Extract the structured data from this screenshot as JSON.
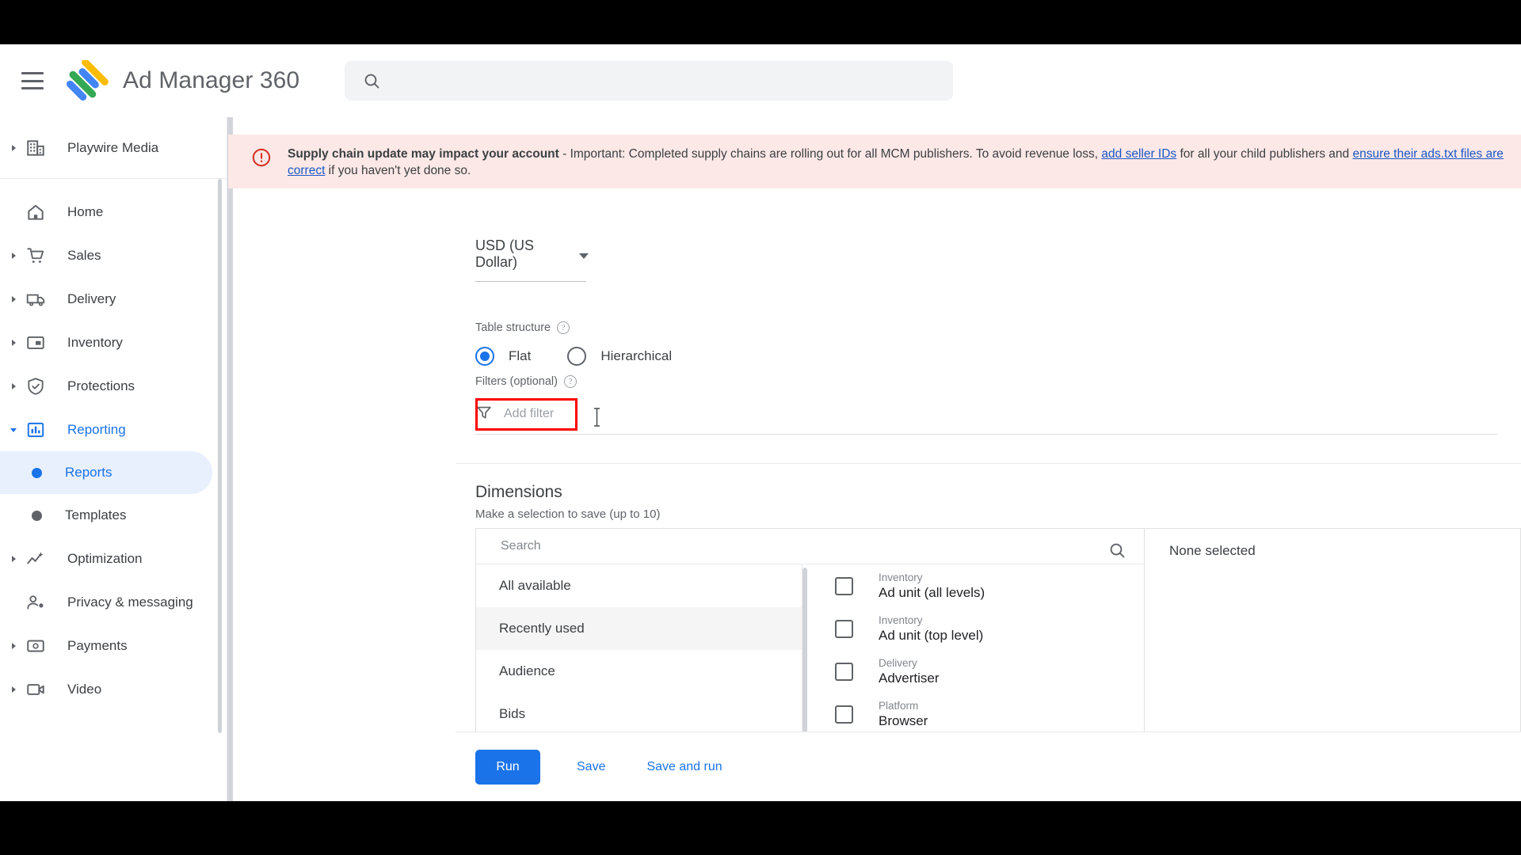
{
  "app": {
    "title": "Ad Manager 360",
    "menu_icon": "hamburger-menu-icon",
    "logo_icon": "ad-manager-logo"
  },
  "search": {
    "placeholder": "",
    "value": "",
    "icon": "search-icon"
  },
  "sidebar": {
    "account": {
      "label": "Playwire Media",
      "icon": "building-icon",
      "expander": "chevron-right-icon"
    },
    "items": [
      {
        "label": "Home",
        "icon": "home-icon",
        "expandable": false,
        "active": false
      },
      {
        "label": "Sales",
        "icon": "cart-icon",
        "expandable": true,
        "active": false
      },
      {
        "label": "Delivery",
        "icon": "truck-icon",
        "expandable": true,
        "active": false
      },
      {
        "label": "Inventory",
        "icon": "inventory-icon",
        "expandable": true,
        "active": false
      },
      {
        "label": "Protections",
        "icon": "shield-check-icon",
        "expandable": true,
        "active": false
      },
      {
        "label": "Reporting",
        "icon": "bar-chart-icon",
        "expandable": true,
        "active": true
      },
      {
        "label": "Optimization",
        "icon": "optimization-icon",
        "expandable": true,
        "active": false
      },
      {
        "label": "Privacy & messaging",
        "icon": "person-gear-icon",
        "expandable": false,
        "active": false
      },
      {
        "label": "Payments",
        "icon": "payments-icon",
        "expandable": true,
        "active": false
      },
      {
        "label": "Video",
        "icon": "video-icon",
        "expandable": true,
        "active": false
      }
    ],
    "sub_items": [
      {
        "label": "Reports",
        "selected": true
      },
      {
        "label": "Templates",
        "selected": false
      }
    ]
  },
  "banner": {
    "icon": "error-circle-icon",
    "headline": "Supply chain update may impact your account",
    "body_1": " - Important: Completed supply chains are rolling out for all MCM publishers. To avoid revenue loss, ",
    "link_1": "add seller IDs",
    "body_2": " for all your child publishers and ",
    "link_2": "ensure their ads.txt files are correct",
    "body_3": " if you haven't yet done so."
  },
  "form": {
    "currency": {
      "value": "USD (US Dollar)",
      "caret": "chevron-down-icon"
    },
    "table_structure": {
      "label": "Table structure",
      "help": "help-icon",
      "options": [
        {
          "label": "Flat",
          "selected": true
        },
        {
          "label": "Hierarchical",
          "selected": false
        }
      ]
    },
    "filters": {
      "label": "Filters (optional)",
      "help": "help-icon",
      "add_filter_placeholder": "Add filter",
      "filter_icon": "filter-funnel-icon",
      "highlight_color": "#ff0000"
    }
  },
  "dimensions": {
    "title": "Dimensions",
    "subtitle": "Make a selection to save (up to 10)",
    "search_placeholder": "Search",
    "search_icon": "search-icon",
    "categories": [
      {
        "label": "All available",
        "highlighted": false
      },
      {
        "label": "Recently used",
        "highlighted": true
      },
      {
        "label": "Audience",
        "highlighted": false
      },
      {
        "label": "Bids",
        "highlighted": false
      }
    ],
    "options": [
      {
        "group": "Inventory",
        "name": "Ad unit (all levels)",
        "checked": false
      },
      {
        "group": "Inventory",
        "name": "Ad unit (top level)",
        "checked": false
      },
      {
        "group": "Delivery",
        "name": "Advertiser",
        "checked": false
      },
      {
        "group": "Platform",
        "name": "Browser",
        "checked": false
      }
    ],
    "selected_panel_label": "None selected"
  },
  "footer": {
    "run_label": "Run",
    "save_label": "Save",
    "save_and_run_label": "Save and run"
  },
  "colors": {
    "accent": "#1a73e8",
    "banner_bg": "#fce8e6",
    "banner_icon": "#d93025",
    "selected_nav_bg": "#e8f0fe",
    "highlight_box": "#ff0000"
  }
}
